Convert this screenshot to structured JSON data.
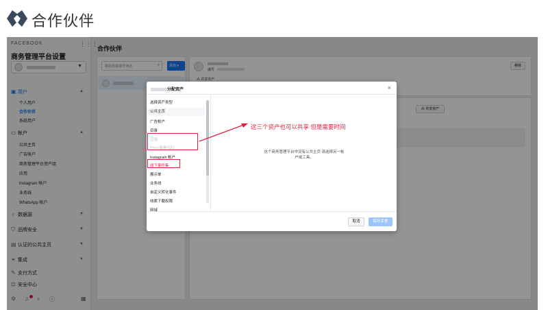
{
  "header": {
    "logo_text": "合作伙伴"
  },
  "sidebar": {
    "brand": "FACEBOOK",
    "title": "商务管理平台设置",
    "sections": [
      {
        "label": "用户",
        "icon": "users-icon",
        "items": [
          "个人用户",
          "合作伙伴",
          "系统用户"
        ]
      },
      {
        "label": "帐户",
        "icon": "folder-icon",
        "items": [
          "公共主页",
          "广告帐户",
          "商务管理平台资产组",
          "应用",
          "Instagram 帐户",
          "业务线",
          "WhatsApp 帐户"
        ]
      },
      {
        "label": "数据源",
        "icon": "people-icon"
      },
      {
        "label": "品牌安全",
        "icon": "shield-icon"
      },
      {
        "label": "认证的公共主页",
        "icon": "check-page-icon"
      },
      {
        "label": "集成",
        "icon": "integration-icon"
      },
      {
        "label": "支付方式",
        "icon": "pencil-icon"
      },
      {
        "label": "安全中心",
        "icon": "lock-icon"
      }
    ]
  },
  "main": {
    "title": "合作伙伴",
    "search_placeholder": "按名称或编号筛选",
    "add_label": "添加",
    "id_label": "编号",
    "remove_label": "移除",
    "share_tab": "共享资产",
    "share_button": "共享资产"
  },
  "modal": {
    "title_suffix": "分配资产",
    "type_heading": "选择资产类型",
    "types": [
      "公共主页",
      "广告帐户",
      "目录",
      "应用",
      "Pixel 像素代码",
      "Instagram 帐户",
      "线下事件集",
      "展示单",
      "业务线",
      "自定义转化事件",
      "线索下载权限",
      "网域"
    ],
    "empty_message": "这个商务管理平台中没有公共主页 请选择另一帐户或工具。",
    "cancel_label": "取消",
    "save_label": "保存变更"
  },
  "annotation": {
    "text": "这三个资产也可以共享 但是需要时间"
  }
}
